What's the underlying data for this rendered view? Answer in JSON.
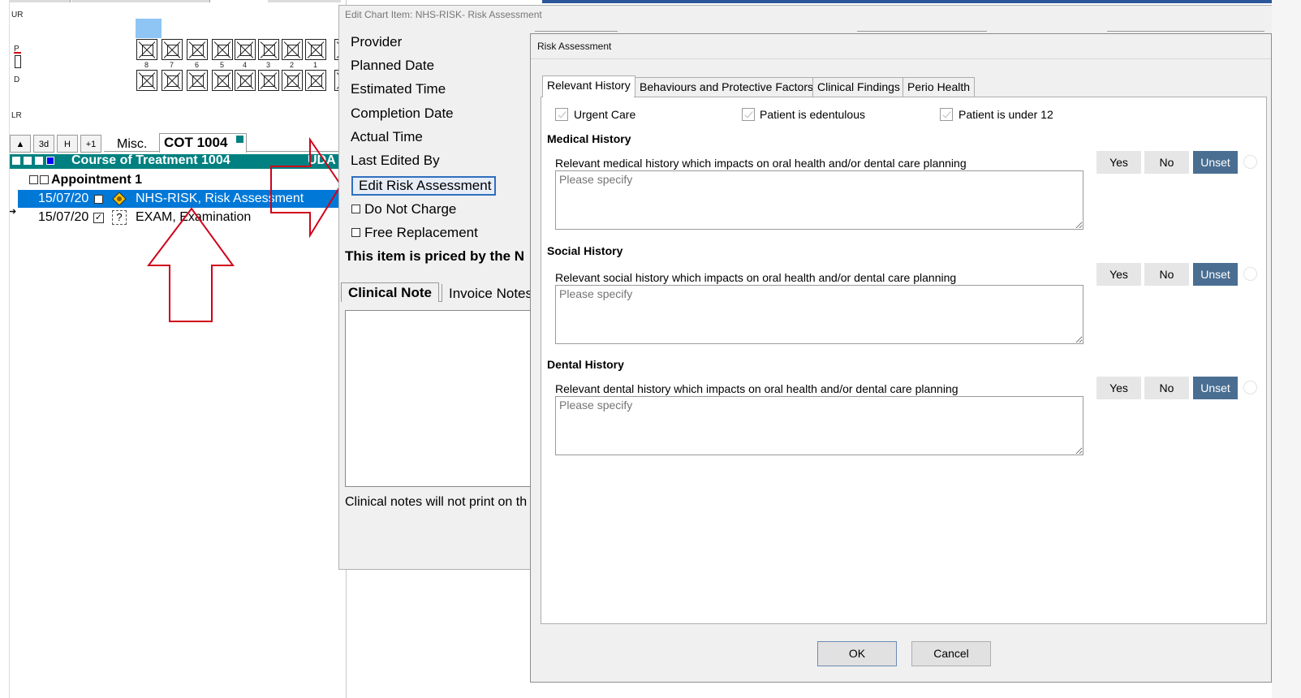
{
  "chart": {
    "labels": {
      "ur": "UR",
      "lr": "LR",
      "p": "P",
      "d": "D"
    },
    "tooth_numbers": [
      "8",
      "7",
      "6",
      "5",
      "4",
      "3",
      "2",
      "1"
    ],
    "toolbar": {
      "up": "▲",
      "three_d": "3d",
      "h": "H",
      "plus_one": "+1"
    },
    "tabs": {
      "misc": "Misc.",
      "cot": "COT 1004"
    },
    "course_bar": "Course of Treatment 1004",
    "course_bar_suffix": "UDA",
    "appointment": "Appointment 1",
    "items": [
      {
        "date": "15/07/20",
        "code": "NHS-RISK, Risk Assessment",
        "selected": true
      },
      {
        "date": "15/07/20",
        "code": "EXAM, Examination",
        "selected": false
      }
    ]
  },
  "edit_dialog": {
    "title": "Edit Chart Item: NHS-RISK- Risk Assessment",
    "fields": [
      "Provider",
      "Planned Date",
      "Estimated Time",
      "Completion Date",
      "Actual Time",
      "Last Edited By"
    ],
    "edit_risk_button": "Edit Risk Assessment",
    "do_not_charge": "Do Not Charge",
    "free_replacement": "Free Replacement",
    "priced_text": "This item is priced by the N",
    "note_tabs": [
      "Clinical Note",
      "Invoice Notes"
    ],
    "note_footer": "Clinical notes will not print on th"
  },
  "risk_dialog": {
    "title": "Risk Assessment",
    "tabs": [
      "Relevant History",
      "Behaviours and Protective Factors",
      "Clinical Findings",
      "Perio Health"
    ],
    "active_tab": "Relevant History",
    "checks": [
      "Urgent Care",
      "Patient is edentulous",
      "Patient is under 12"
    ],
    "sections": [
      {
        "heading": "Medical History",
        "question": "Relevant medical history which impacts on oral health and/or dental care planning",
        "placeholder": "Please specify"
      },
      {
        "heading": "Social History",
        "question": "Relevant social history which impacts on oral health and/or dental care planning",
        "placeholder": "Please specify"
      },
      {
        "heading": "Dental History",
        "question": "Relevant dental history which impacts on oral health and/or dental care planning",
        "placeholder": "Please specify"
      }
    ],
    "answer_buttons": {
      "yes": "Yes",
      "no": "No",
      "unset": "Unset"
    },
    "ok": "OK",
    "cancel": "Cancel"
  },
  "colors": {
    "teal_bar": "#008080",
    "selection_blue": "#0078d7",
    "unset_button": "#4a6e92",
    "annotation_red": "#d0021b"
  },
  "icons": [
    "tooth-icon",
    "risk-diamond-icon",
    "question-icon",
    "annotation-arrow-up",
    "annotation-arrow-right"
  ]
}
